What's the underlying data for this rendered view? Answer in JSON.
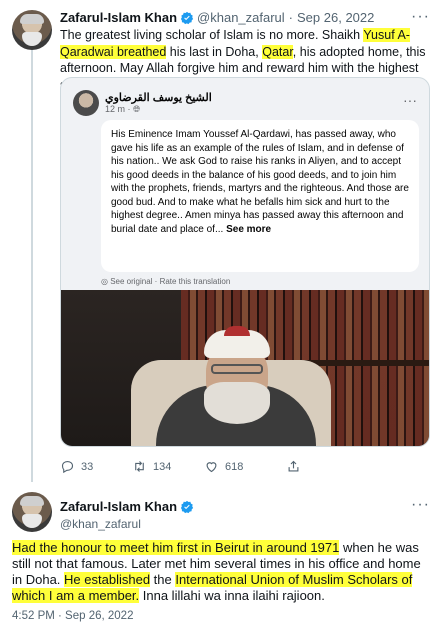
{
  "tweet1": {
    "author_name": "Zafarul-Islam Khan",
    "handle": "@khan_zafarul",
    "separator": "·",
    "date": "Sep 26, 2022",
    "text_parts": [
      {
        "text": "The greatest living scholar of Islam is no more. Shaikh ",
        "highlight": false
      },
      {
        "text": "Yusuf A-Qaradwai breathed",
        "highlight": true
      },
      {
        "text": " his last in Doha, ",
        "highlight": false
      },
      {
        "text": "Qatar",
        "highlight": true
      },
      {
        "text": ", his adopted home, this afternoon. May Allah forgive him and reward him with the highest station in Paradise.",
        "highlight": false
      }
    ],
    "quote": {
      "page_name": "الشيخ يوسف القرضاوي",
      "time_ago": "12 m ·",
      "body": "His Eminence Imam Youssef Al-Qardawi, has passed away, who gave his life as an example of the rules of Islam, and in defense of his nation.. We ask God to raise his ranks in Aliyen, and to accept his good deeds in the balance of his good deeds, and to join him with the prophets, friends, martyrs and the righteous. And those are good bud. And to make what he befalls him sick and hurt to the highest degree.. Amen minya has passed away this afternoon and burial date and place of...",
      "see_more": "See more",
      "translation_links": "See original · Rate this translation"
    },
    "actions": {
      "reply_count": "33",
      "retweet_count": "134",
      "like_count": "618"
    }
  },
  "tweet2": {
    "author_name": "Zafarul-Islam Khan",
    "handle": "@khan_zafarul",
    "text_parts": [
      {
        "text": "Had the honour to meet him first in Beirut in around 1971",
        "highlight": true
      },
      {
        "text": " when he was still not that famous. Later met him several times in his office and home in Doha. ",
        "highlight": false
      },
      {
        "text": "He established",
        "highlight": true
      },
      {
        "text": " the ",
        "highlight": false
      },
      {
        "text": "International Union of Muslim Scholars of which I am a member.",
        "highlight": true
      },
      {
        "text": " Inna lillahi wa inna ilaihi rajioon.",
        "highlight": false
      }
    ],
    "timestamp": "4:52 PM · Sep 26, 2022"
  },
  "icons": {
    "verified": "verified-badge-icon",
    "more": "more-options-icon",
    "reply": "reply-icon",
    "retweet": "retweet-icon",
    "like": "heart-icon",
    "share": "share-icon",
    "globe": "globe-icon"
  },
  "colors": {
    "highlight": "#ffff3a",
    "verified_blue": "#1d9bf0",
    "secondary_text": "#536471"
  }
}
